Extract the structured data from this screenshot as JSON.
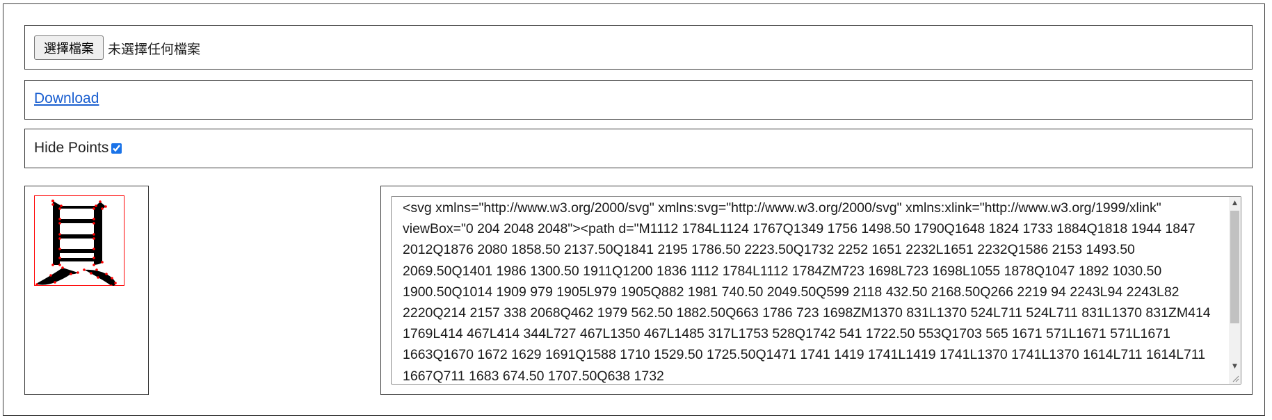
{
  "file_input": {
    "button_label": "選擇檔案",
    "status": "未選擇任何檔案"
  },
  "download": {
    "label": "Download"
  },
  "hide_points": {
    "label": "Hide Points",
    "checked": true
  },
  "preview": {
    "glyph_color": "#000000",
    "point_color": "#ff0000",
    "frame_color": "#ff0000"
  },
  "svg_code": {
    "text": "<svg xmlns=\"http://www.w3.org/2000/svg\" xmlns:svg=\"http://www.w3.org/2000/svg\" xmlns:xlink=\"http://www.w3.org/1999/xlink\" viewBox=\"0 204 2048 2048\"><path d=\"M1112 1784L1124 1767Q1349 1756 1498.50 1790Q1648 1824 1733 1884Q1818 1944 1847 2012Q1876 2080 1858.50 2137.50Q1841 2195 1786.50 2223.50Q1732 2252 1651 2232L1651 2232Q1586 2153 1493.50 2069.50Q1401 1986 1300.50 1911Q1200 1836 1112 1784L1112 1784ZM723 1698L723 1698L1055 1878Q1047 1892 1030.50 1900.50Q1014 1909 979 1905L979 1905Q882 1981 740.50 2049.50Q599 2118 432.50 2168.50Q266 2219 94 2243L94 2243L82 2220Q214 2157 338 2068Q462 1979 562.50 1882.50Q663 1786 723 1698ZM1370 831L1370 524L711 524L711 831L1370 831ZM414 1769L414 467L414 344L727 467L1350 467L1485 317L1753 528Q1742 541 1722.50 553Q1703 565 1671 571L1671 571L1671 1663Q1670 1672 1629 1691Q1588 1710 1529.50 1725.50Q1471 1741 1419 1741L1419 1741L1370 1741L1370 1614L711 1614L711 1667Q711 1683 674.50 1707.50Q638 1732"
  }
}
